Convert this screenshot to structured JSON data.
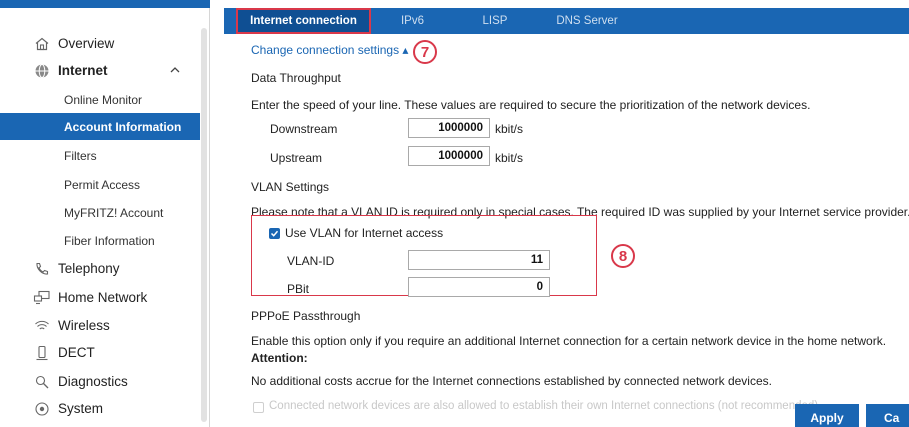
{
  "sidebar": {
    "items": [
      {
        "label": "Overview",
        "icon": "home-icon"
      },
      {
        "label": "Internet",
        "icon": "globe-icon"
      },
      {
        "label": "Telephony",
        "icon": "phone-icon"
      },
      {
        "label": "Home Network",
        "icon": "network-icon"
      },
      {
        "label": "Wireless",
        "icon": "wifi-icon"
      },
      {
        "label": "DECT",
        "icon": "dect-icon"
      },
      {
        "label": "Diagnostics",
        "icon": "diagnostics-icon"
      },
      {
        "label": "System",
        "icon": "system-icon"
      }
    ],
    "internet_sub": [
      {
        "label": "Online Monitor"
      },
      {
        "label": "Account Information",
        "active": true
      },
      {
        "label": "Filters"
      },
      {
        "label": "Permit Access"
      },
      {
        "label": "MyFRITZ! Account"
      },
      {
        "label": "Fiber Information"
      }
    ]
  },
  "tabs": [
    {
      "label": "Internet connection",
      "active": true
    },
    {
      "label": "IPv6"
    },
    {
      "label": "LISP"
    },
    {
      "label": "DNS Server"
    }
  ],
  "main": {
    "change_link": "Change connection settings ▴",
    "step7": "7",
    "step8": "8",
    "throughput": {
      "title": "Data Throughput",
      "desc": "Enter the speed of your line. These values are required to secure the prioritization of the network devices.",
      "downstream_label": "Downstream",
      "downstream_value": "1000000",
      "upstream_label": "Upstream",
      "upstream_value": "1000000",
      "unit": "kbit/s"
    },
    "vlan": {
      "title": "VLAN Settings",
      "desc": "Please note that a VLAN ID is required only in special cases. The required ID was supplied by your Internet service provider.",
      "checkbox_label": "Use VLAN for Internet access",
      "checked": true,
      "id_label": "VLAN-ID",
      "id_value": "11",
      "pbit_label": "PBit",
      "pbit_value": "0"
    },
    "pppoe": {
      "title": "PPPoE Passthrough",
      "desc": "Enable this option only if you require an additional Internet connection for a certain network device in the home network.",
      "attention": "Attention:",
      "note": "No additional costs accrue for the Internet connections established by connected network devices.",
      "checkbox_label": "Connected network devices are also allowed to establish their own Internet connections (not recommended)"
    },
    "apply_label": "Apply",
    "cancel_label": "Ca"
  },
  "colors": {
    "accent": "#1a66b3",
    "highlight": "#d9384a"
  }
}
